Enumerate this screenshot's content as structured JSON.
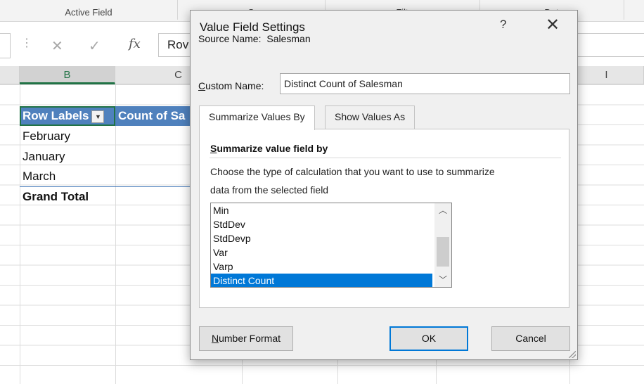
{
  "ribbon": {
    "groups": [
      "Active Field",
      "G",
      "Filt",
      "Dat"
    ]
  },
  "formula_bar": {
    "cancel_icon": "close-icon",
    "enter_icon": "check-icon",
    "fx": "fx",
    "formula_text": "Rov"
  },
  "columns": [
    "B",
    "C",
    "I"
  ],
  "pivot": {
    "header_row_labels": "Row Labels",
    "header_value": "Count of Sa",
    "rows": [
      "February",
      "January",
      "March"
    ],
    "grand_total": "Grand Total",
    "header_color": "#4f81bd"
  },
  "dialog": {
    "title": "Value Field Settings",
    "help": "?",
    "close": "✕",
    "source_label": "Source Name:",
    "source_value": "Salesman",
    "custom_name_label_u": "C",
    "custom_name_label_rest": "ustom Name:",
    "custom_name_value": "Distinct Count of Salesman",
    "tabs": [
      "Summarize Values By",
      "Show Values As"
    ],
    "summarize_title_u": "S",
    "summarize_title_rest": "ummarize value field by",
    "description_line1": "Choose the type of calculation that you want to use to summarize",
    "description_line2": "data from the selected field",
    "list_items": [
      "Min",
      "StdDev",
      "StdDevp",
      "Var",
      "Varp",
      "Distinct Count"
    ],
    "selected_item": "Distinct Count",
    "number_format_u": "N",
    "number_format_rest": "umber Format",
    "ok_label": "OK",
    "cancel_label": "Cancel",
    "accent_color": "#0078d7"
  }
}
